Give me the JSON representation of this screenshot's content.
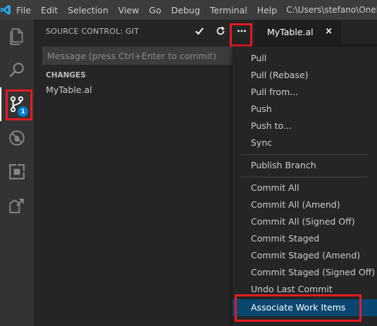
{
  "titlebar": {
    "menus": [
      "File",
      "Edit",
      "Selection",
      "View",
      "Go",
      "Debug",
      "Terminal",
      "Help"
    ],
    "path": "C:\\Users\\stefano\\OneDrive"
  },
  "activitybar": {
    "items": [
      "explorer-icon",
      "search-icon",
      "source-control-icon",
      "debug-icon",
      "extensions-icon",
      "remote-explorer-icon"
    ],
    "scm_badge": "1"
  },
  "sidebar": {
    "title": "SOURCE CONTROL: GIT",
    "commit_placeholder": "Message (press Ctrl+Enter to commit)",
    "commit_value": "",
    "changes_header": "CHANGES",
    "changes": [
      "MyTable.al"
    ],
    "actions": [
      "commit-check-icon",
      "refresh-icon",
      "more-actions-icon"
    ]
  },
  "editor": {
    "tab_label": "MyTable.al",
    "tab_close": "×"
  },
  "context_menu": {
    "groups": [
      [
        "Pull",
        "Pull (Rebase)",
        "Pull from...",
        "Push",
        "Push to...",
        "Sync"
      ],
      [
        "Publish Branch"
      ],
      [
        "Commit All",
        "Commit All (Amend)",
        "Commit All (Signed Off)",
        "Commit Staged",
        "Commit Staged (Amend)",
        "Commit Staged (Signed Off)",
        "Undo Last Commit",
        "Associate Work Items"
      ]
    ],
    "selected": "Associate Work Items"
  },
  "colors": {
    "accent": "#007acc",
    "highlight_box": "#e51a22",
    "menu_selection": "#094771",
    "vscode_logo": "#23a9f2"
  }
}
